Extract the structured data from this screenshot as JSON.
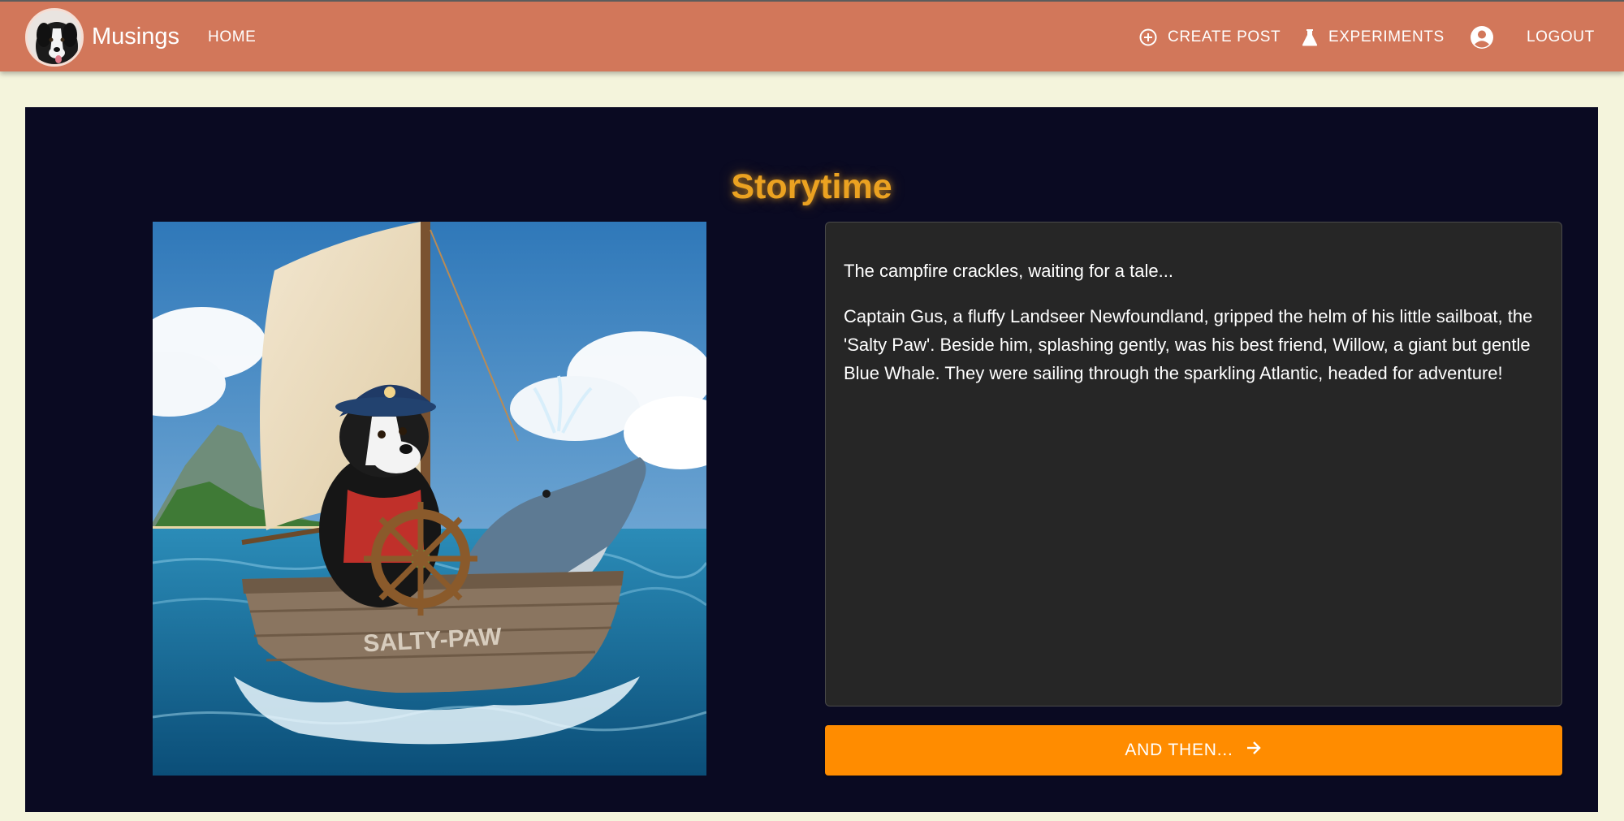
{
  "header": {
    "brand": "Musings",
    "nav": {
      "home": "HOME",
      "create_post": "CREATE POST",
      "experiments": "EXPERIMENTS",
      "logout": "LOGOUT"
    }
  },
  "story": {
    "title": "Storytime",
    "intro": "The campfire crackles, waiting for a tale...",
    "body": "Captain Gus, a fluffy Landseer Newfoundland, gripped the helm of his little sailboat, the 'Salty Paw'. Beside him, splashing gently, was his best friend, Willow, a giant but gentle Blue Whale. They were sailing through the sparkling Atlantic, headed for adventure!",
    "boat_name": "SALTY-PAW",
    "next_label": "AND THEN..."
  },
  "icons": {
    "create_post": "add-circle-icon",
    "experiments": "flask-icon",
    "account": "account-circle-icon",
    "next": "arrow-right-icon"
  },
  "colors": {
    "appbar": "#d2775a",
    "page_background": "#f4f4dc",
    "panel_background": "#0a0a22",
    "title": "#eba221",
    "story_box": "#262626",
    "button": "#ff8c00"
  }
}
